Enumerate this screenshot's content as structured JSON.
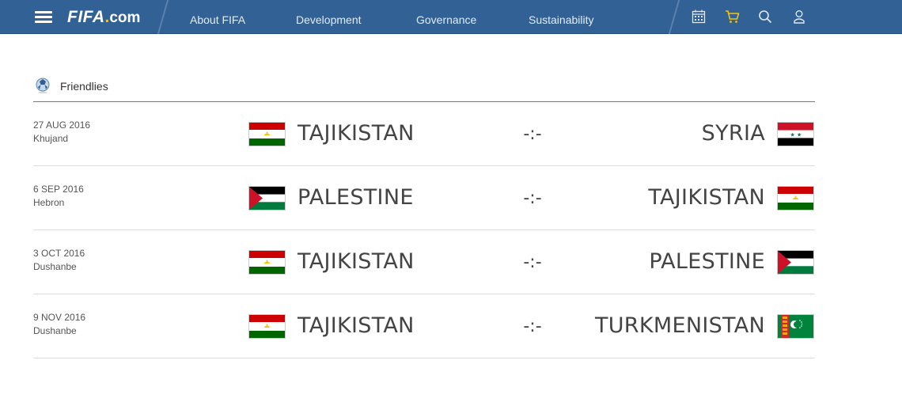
{
  "header": {
    "logo_main": "FIFA",
    "logo_dot": ".",
    "logo_com": "com",
    "nav": [
      "About FIFA",
      "Development",
      "Governance",
      "Sustainability"
    ],
    "colors": {
      "bar": "#326295",
      "accent": "#f7c20c"
    },
    "tools": [
      "calendar-icon",
      "cart-icon",
      "search-icon",
      "user-icon"
    ]
  },
  "section": {
    "title": "Friendlies",
    "icon": "football-icon"
  },
  "matches": [
    {
      "date": "27 AUG 2016",
      "venue": "Khujand",
      "home": "TAJIKISTAN",
      "away": "SYRIA",
      "score": "-:-"
    },
    {
      "date": "6 SEP 2016",
      "venue": "Hebron",
      "home": "PALESTINE",
      "away": "TAJIKISTAN",
      "score": "-:-"
    },
    {
      "date": "3 OCT 2016",
      "venue": "Dushanbe",
      "home": "TAJIKISTAN",
      "away": "PALESTINE",
      "score": "-:-"
    },
    {
      "date": "9 NOV 2016",
      "venue": "Dushanbe",
      "home": "TAJIKISTAN",
      "away": "TURKMENISTAN",
      "score": "-:-"
    }
  ]
}
